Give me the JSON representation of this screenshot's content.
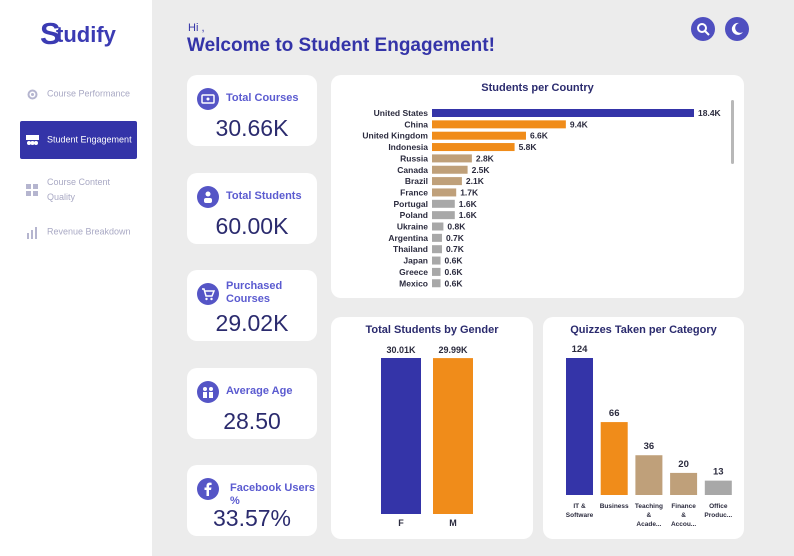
{
  "app": {
    "logo_first": "S",
    "logo_rest": "tudify"
  },
  "sidebar": {
    "items": [
      {
        "label": "Course Performance",
        "icon": "gear-chart-icon"
      },
      {
        "label": "Student Engagement",
        "icon": "group-icon"
      },
      {
        "label": "Course Content Quality",
        "icon": "grid-icon"
      },
      {
        "label": "Revenue Breakdown",
        "icon": "bar-chart-icon"
      }
    ]
  },
  "header": {
    "greeting": "Hi ,",
    "title": "Welcome to Student Engagement!"
  },
  "kpis": [
    {
      "label": "Total Courses",
      "value": "30.66K",
      "icon": "course-icon"
    },
    {
      "label": "Total Students",
      "value": "60.00K",
      "icon": "students-icon"
    },
    {
      "label": "Purchased Courses",
      "value": "29.02K",
      "icon": "cart-icon"
    },
    {
      "label": "Average Age",
      "value": "28.50",
      "icon": "age-icon"
    },
    {
      "label": "Facebook Users %",
      "value": "33.57%",
      "icon": "facebook-icon"
    }
  ],
  "colors": {
    "primary": "#3434a8",
    "orange": "#f08c1a",
    "tan": "#bfa07a",
    "gray": "#a8a8a8"
  },
  "chart_data": [
    {
      "type": "bar",
      "orientation": "horizontal",
      "title": "Students per Country",
      "categories": [
        "United States",
        "China",
        "United Kingdom",
        "Indonesia",
        "Russia",
        "Canada",
        "Brazil",
        "France",
        "Portugal",
        "Poland",
        "Ukraine",
        "Argentina",
        "Thailand",
        "Japan",
        "Greece",
        "Mexico"
      ],
      "values": [
        18.4,
        9.4,
        6.6,
        5.8,
        2.8,
        2.5,
        2.1,
        1.7,
        1.6,
        1.6,
        0.8,
        0.7,
        0.7,
        0.6,
        0.6,
        0.6
      ],
      "labels": [
        "18.4K",
        "9.4K",
        "6.6K",
        "5.8K",
        "2.8K",
        "2.5K",
        "2.1K",
        "1.7K",
        "1.6K",
        "1.6K",
        "0.8K",
        "0.7K",
        "0.7K",
        "0.6K",
        "0.6K",
        "0.6K"
      ],
      "colors": [
        "#3434a8",
        "#f08c1a",
        "#f08c1a",
        "#f08c1a",
        "#bfa07a",
        "#bfa07a",
        "#bfa07a",
        "#bfa07a",
        "#a8a8a8",
        "#a8a8a8",
        "#a8a8a8",
        "#a8a8a8",
        "#a8a8a8",
        "#a8a8a8",
        "#a8a8a8",
        "#a8a8a8"
      ],
      "xlim": [
        0,
        18.4
      ]
    },
    {
      "type": "bar",
      "title": "Total Students by Gender",
      "categories": [
        "F",
        "M"
      ],
      "values": [
        30.01,
        29.99
      ],
      "labels": [
        "30.01K",
        "29.99K"
      ],
      "colors": [
        "#3434a8",
        "#f08c1a"
      ],
      "ylim": [
        0,
        30.01
      ]
    },
    {
      "type": "bar",
      "title": "Quizzes Taken per Category",
      "categories": [
        [
          "IT &",
          "Software"
        ],
        [
          "Business"
        ],
        [
          "Teaching",
          "&",
          "Acade..."
        ],
        [
          "Finance",
          "&",
          "Accou..."
        ],
        [
          "Office",
          "Produc..."
        ]
      ],
      "values": [
        124,
        66,
        36,
        20,
        13
      ],
      "labels": [
        "124",
        "66",
        "36",
        "20",
        "13"
      ],
      "colors": [
        "#3434a8",
        "#f08c1a",
        "#bfa07a",
        "#bfa07a",
        "#a8a8a8"
      ],
      "ylim": [
        0,
        124
      ]
    }
  ]
}
